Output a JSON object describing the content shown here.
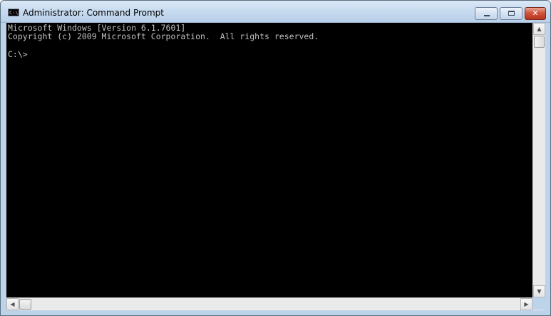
{
  "window": {
    "title": "Administrator: Command Prompt",
    "icon": "command-prompt-icon",
    "icon_text": "C:\\",
    "controls": {
      "minimize": "minimize-icon",
      "maximize": "maximize-icon",
      "close": "close-icon",
      "close_glyph": "✕"
    }
  },
  "console": {
    "lines": [
      "Microsoft Windows [Version 6.1.7601]",
      "Copyright (c) 2009 Microsoft Corporation.  All rights reserved.",
      "",
      "C:\\>"
    ],
    "background": "#000000",
    "foreground": "#c0c0c0"
  },
  "scrollbars": {
    "up_arrow": "▲",
    "down_arrow": "▼",
    "left_arrow": "◀",
    "right_arrow": "▶"
  }
}
